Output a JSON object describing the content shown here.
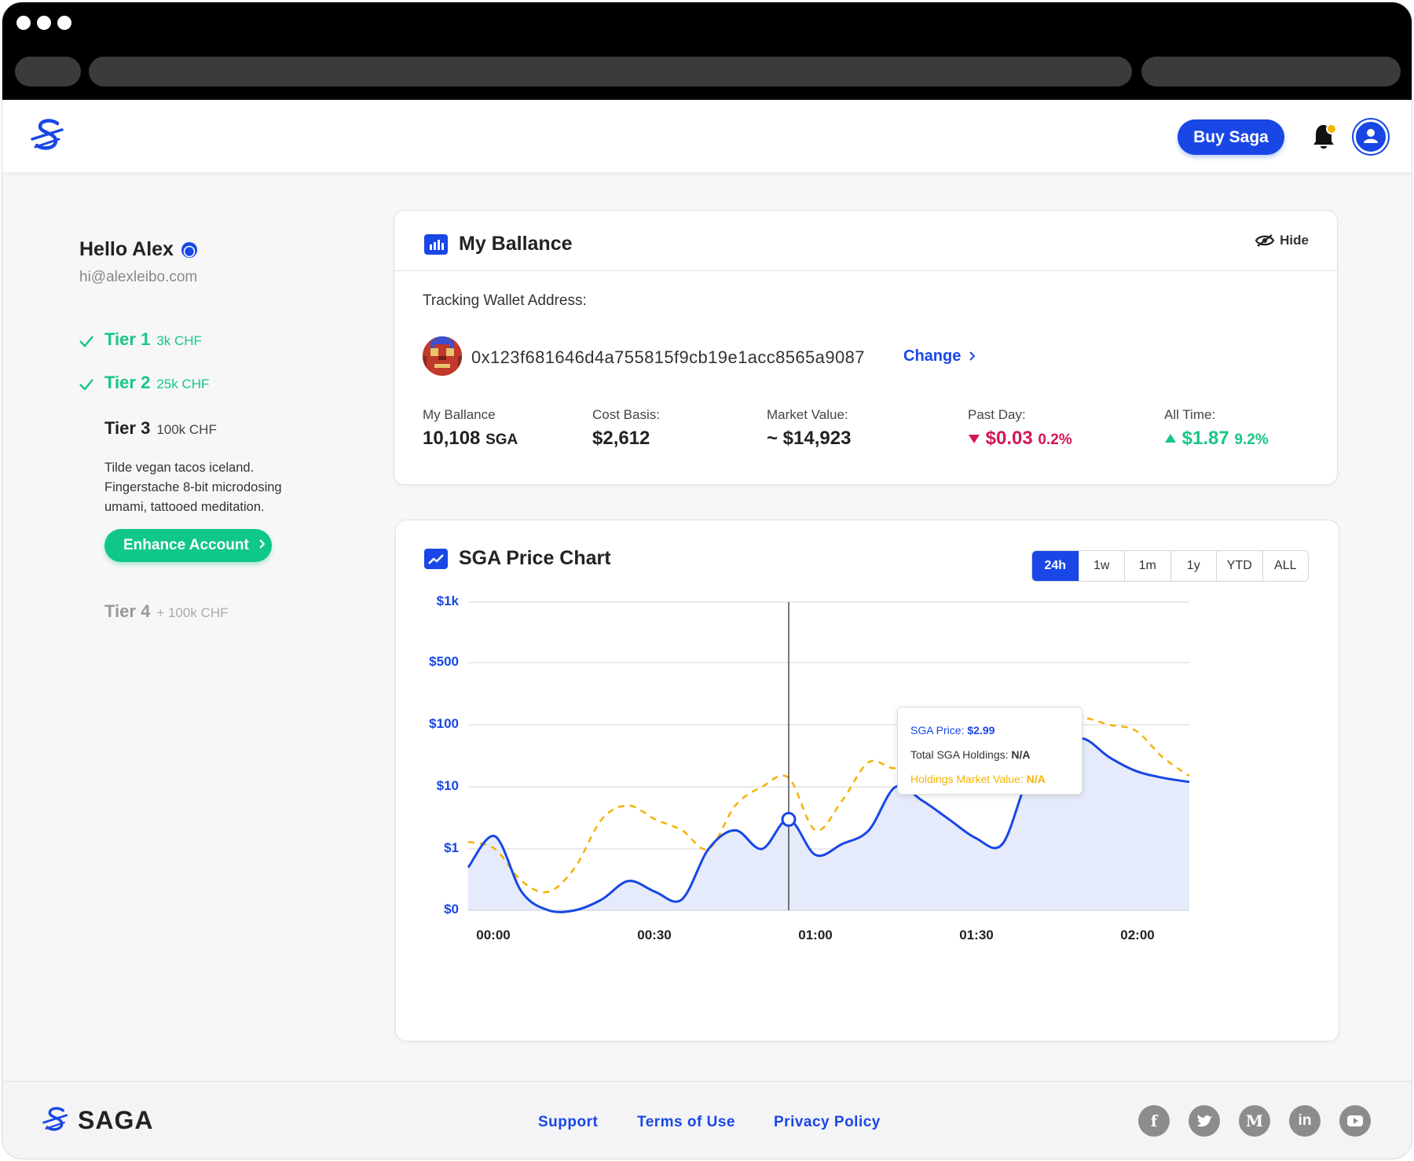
{
  "header": {
    "buy_label": "Buy Saga"
  },
  "user": {
    "greeting": "Hello Alex",
    "email": "hi@alexleibo.com"
  },
  "tiers": [
    {
      "name": "Tier 1",
      "amount": "3k CHF",
      "status": "done"
    },
    {
      "name": "Tier 2",
      "amount": "25k CHF",
      "status": "done"
    },
    {
      "name": "Tier 3",
      "amount": "100k CHF",
      "status": "current"
    },
    {
      "name": "Tier 4",
      "amount": "+ 100k CHF",
      "status": "locked"
    }
  ],
  "tier_description": "Tilde vegan tacos iceland. Fingerstache 8-bit microdosing umami, tattooed meditation.",
  "enhance_label": "Enhance Account",
  "balance_card": {
    "title": "My Ballance",
    "hide_label": "Hide",
    "tracking_label": "Tracking Wallet Address:",
    "wallet_address": "0x123f681646d4a755815f9cb19e1acc8565a9087",
    "change_label": "Change",
    "stats": {
      "balance_label": "My Ballance",
      "balance_value": "10,108",
      "balance_unit": "SGA",
      "cost_label": "Cost Basis:",
      "cost_value": "$2,612",
      "market_label": "Market Value:",
      "market_value": "~ $14,923",
      "day_label": "Past Day:",
      "day_value": "$0.03",
      "day_pct": "0.2%",
      "all_label": "All Time:",
      "all_value": "$1.87",
      "all_pct": "9.2%"
    }
  },
  "chart_card": {
    "title": "SGA Price Chart",
    "ranges": [
      "24h",
      "1w",
      "1m",
      "1y",
      "YTD",
      "ALL"
    ],
    "active_range": "24h",
    "tooltip": {
      "price_label": "SGA Price:",
      "price_value": "$2.99",
      "holdings_label": "Total SGA Holdings:",
      "holdings_value": "N/A",
      "mv_label": "Holdings Market Value:",
      "mv_value": "N/A"
    }
  },
  "chart_data": {
    "type": "line",
    "yscale": "log",
    "yticks": [
      "$0",
      "$1",
      "$10",
      "$100",
      "$500",
      "$1k"
    ],
    "xticks": [
      "00:00",
      "00:30",
      "01:00",
      "01:30",
      "02:00"
    ],
    "x": [
      "00:00",
      "00:05",
      "00:10",
      "00:15",
      "00:20",
      "00:25",
      "00:30",
      "00:35",
      "00:40",
      "00:45",
      "00:50",
      "00:55",
      "01:00",
      "01:05",
      "01:10",
      "01:15",
      "01:20",
      "01:25",
      "01:30",
      "01:35",
      "01:40",
      "01:45",
      "01:50",
      "01:55",
      "02:00",
      "02:05",
      "02:10",
      "02:15"
    ],
    "series": [
      {
        "color": "#1847e6",
        "style": "solid-area",
        "values": [
          0.5,
          1.6,
          0.2,
          0.1,
          0.1,
          0.15,
          0.3,
          0.2,
          0.15,
          1,
          2,
          1,
          3,
          0.8,
          1.2,
          2,
          10,
          6,
          3,
          1.5,
          1.2,
          15,
          40,
          60,
          30,
          18,
          14,
          12
        ]
      },
      {
        "color": "#f5b300",
        "style": "dashed",
        "values": [
          1.3,
          1,
          0.3,
          0.2,
          0.5,
          3,
          5,
          3,
          2,
          1,
          5,
          10,
          14,
          2,
          6,
          25,
          20,
          35,
          150,
          100,
          80,
          90,
          110,
          120,
          100,
          80,
          30,
          15
        ]
      }
    ],
    "cursor_x": "01:00",
    "cursor_value": 2.99
  },
  "footer": {
    "brand": "SAGA",
    "links": [
      "Support",
      "Terms of Use",
      "Privacy Policy"
    ],
    "social_icons": [
      "facebook-icon",
      "twitter-icon",
      "medium-icon",
      "linkedin-icon",
      "youtube-icon"
    ]
  },
  "colors": {
    "accent": "#1847e6",
    "success": "#16c784",
    "danger": "#d4145a",
    "secondary": "#f5b300"
  }
}
